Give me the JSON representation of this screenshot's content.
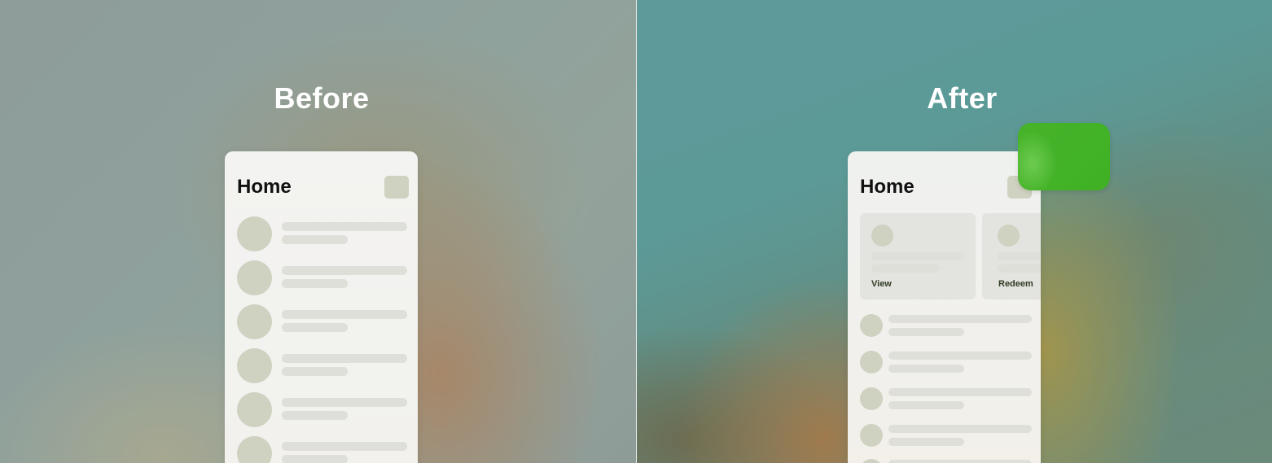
{
  "before": {
    "title": "Before",
    "phone": {
      "header": "Home",
      "list_rows": 6
    }
  },
  "after": {
    "title": "After",
    "phone": {
      "header": "Home",
      "cards": [
        {
          "action_label": "View"
        },
        {
          "action_label": "Redeem"
        }
      ],
      "list_rows": 5
    }
  },
  "colors": {
    "placeholder_avatar": "#cfd1c1",
    "placeholder_line": "#dfdfda",
    "toast_green": "#44b228",
    "card_label": "#2f3b22"
  }
}
